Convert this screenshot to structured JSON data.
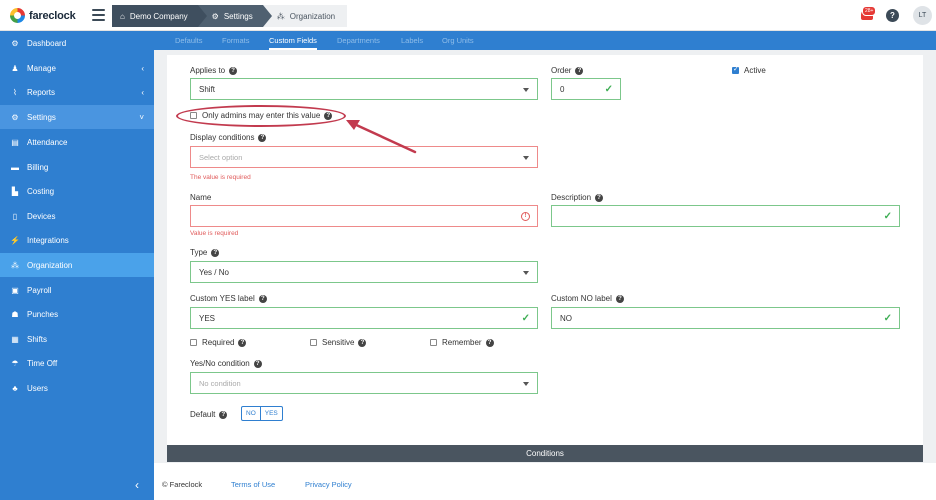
{
  "brand": {
    "name": "fareclock"
  },
  "breadcrumbs": [
    {
      "label": "Demo Company",
      "icon": "home-icon"
    },
    {
      "label": "Settings",
      "icon": "gear-icon"
    },
    {
      "label": "Organization",
      "icon": "org-chart-icon"
    }
  ],
  "header": {
    "notification_count": "28+",
    "help": "?",
    "avatar_initials": "LT"
  },
  "sidebar": {
    "items": [
      {
        "label": "Dashboard",
        "icon": "dashboard-icon",
        "glyph": "⚙"
      },
      {
        "label": "Manage",
        "icon": "person-icon",
        "glyph": "♟",
        "chevron": "‹"
      },
      {
        "label": "Reports",
        "icon": "chart-icon",
        "glyph": "⌇",
        "chevron": "‹"
      },
      {
        "label": "Settings",
        "icon": "gear-icon",
        "glyph": "⚙",
        "chevron": "˅"
      },
      {
        "label": "Attendance",
        "icon": "attendance-icon",
        "glyph": "▤"
      },
      {
        "label": "Billing",
        "icon": "billing-icon",
        "glyph": "▬"
      },
      {
        "label": "Costing",
        "icon": "costing-icon",
        "glyph": "▙"
      },
      {
        "label": "Devices",
        "icon": "device-icon",
        "glyph": "▯"
      },
      {
        "label": "Integrations",
        "icon": "plug-icon",
        "glyph": "⚡"
      },
      {
        "label": "Organization",
        "icon": "org-chart-icon",
        "glyph": "⁂"
      },
      {
        "label": "Payroll",
        "icon": "payroll-icon",
        "glyph": "▣"
      },
      {
        "label": "Punches",
        "icon": "punches-icon",
        "glyph": "☗"
      },
      {
        "label": "Shifts",
        "icon": "shifts-icon",
        "glyph": "▦"
      },
      {
        "label": "Time Off",
        "icon": "beach-icon",
        "glyph": "☂"
      },
      {
        "label": "Users",
        "icon": "users-icon",
        "glyph": "♣"
      }
    ],
    "collapse": "‹"
  },
  "tabs": [
    "Defaults",
    "Formats",
    "Custom Fields",
    "Departments",
    "Labels",
    "Org Units"
  ],
  "form": {
    "applies_to": {
      "label": "Applies to",
      "value": "Shift"
    },
    "order": {
      "label": "Order",
      "value": "0"
    },
    "active": {
      "label": "Active"
    },
    "only_admins": {
      "label": "Only admins may enter this value"
    },
    "display_conditions": {
      "label": "Display conditions",
      "placeholder": "Select option",
      "error": "The value is required"
    },
    "name": {
      "label": "Name",
      "error": "Value is required"
    },
    "description": {
      "label": "Description"
    },
    "type": {
      "label": "Type",
      "value": "Yes / No"
    },
    "custom_yes": {
      "label": "Custom YES label",
      "value": "YES"
    },
    "custom_no": {
      "label": "Custom NO label",
      "value": "NO"
    },
    "required": {
      "label": "Required"
    },
    "sensitive": {
      "label": "Sensitive"
    },
    "remember": {
      "label": "Remember"
    },
    "yes_no_condition": {
      "label": "Yes/No condition",
      "placeholder": "No condition"
    },
    "default": {
      "label": "Default",
      "no": "NO",
      "yes": "YES"
    }
  },
  "conditions_bar": "Conditions",
  "footer": {
    "copyright": "© Fareclock",
    "terms": "Terms of Use",
    "privacy": "Privacy Policy"
  },
  "colors": {
    "primary": "#2f7fd0",
    "success": "#3fae55",
    "error": "#e05a5a",
    "annotation": "#c23a4e"
  }
}
